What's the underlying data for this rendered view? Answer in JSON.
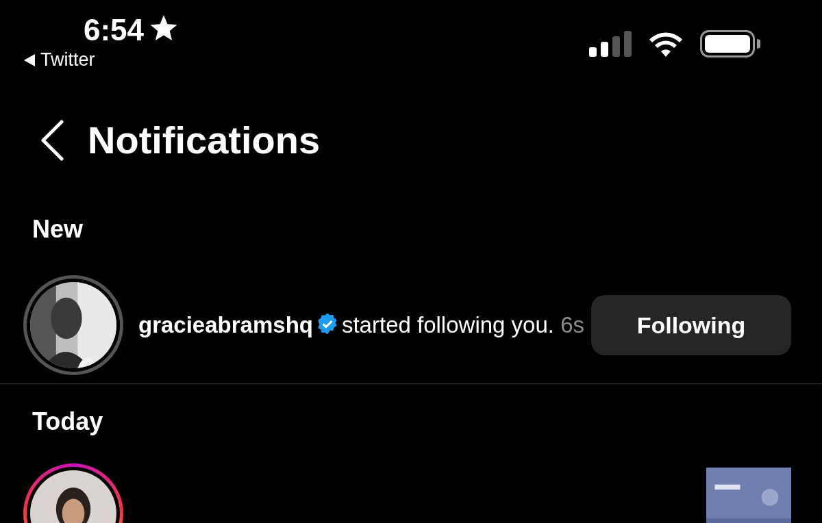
{
  "status_bar": {
    "time": "6:54",
    "back_app": "Twitter"
  },
  "header": {
    "title": "Notifications"
  },
  "sections": [
    {
      "title": "New",
      "items": [
        {
          "kind": "follow",
          "story_ring": false,
          "username": "gracieabramshq",
          "verified": true,
          "text": "started following you.",
          "time": "6s",
          "button": "Following"
        }
      ]
    },
    {
      "title": "Today",
      "items": [
        {
          "kind": "post",
          "story_ring": true
        }
      ]
    }
  ]
}
